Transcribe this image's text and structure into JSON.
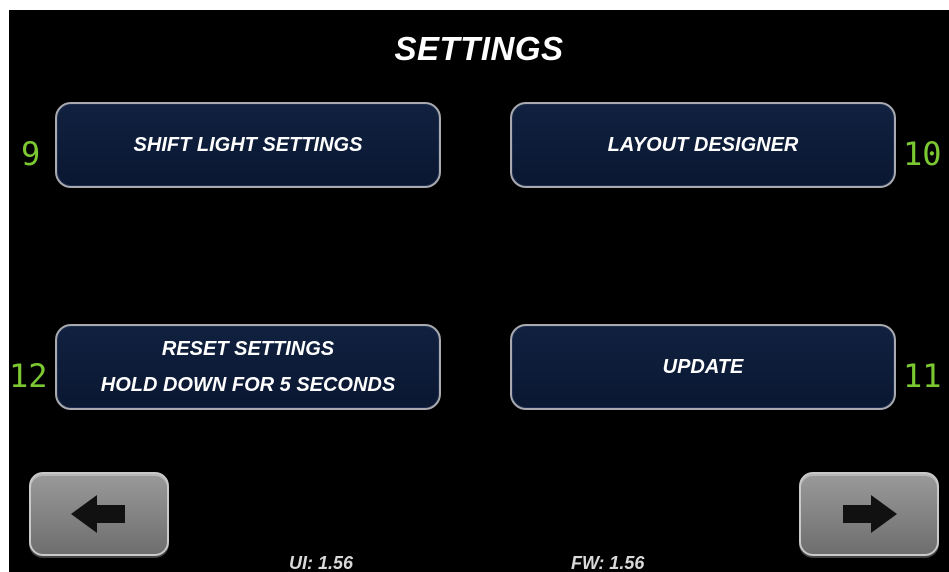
{
  "screen": {
    "title": "SETTINGS"
  },
  "buttons": {
    "shift_light": {
      "label": "SHIFT LIGHT SETTINGS",
      "number": "9"
    },
    "layout_designer": {
      "label": "LAYOUT DESIGNER",
      "number": "10"
    },
    "reset_settings": {
      "line1": "RESET SETTINGS",
      "line2": "HOLD DOWN FOR 5 SECONDS",
      "number": "12"
    },
    "update": {
      "label": "UPDATE",
      "number": "11"
    }
  },
  "navigation": {
    "back_icon": "arrow-left-icon",
    "forward_icon": "arrow-right-icon"
  },
  "footer": {
    "ui_version": "UI: 1.56",
    "fw_version": "FW: 1.56"
  },
  "colors": {
    "background": "#000000",
    "button_fill": "#0f1f3d",
    "button_border": "#a8aab0",
    "number_green": "#7cc832",
    "nav_button": "#858585"
  }
}
